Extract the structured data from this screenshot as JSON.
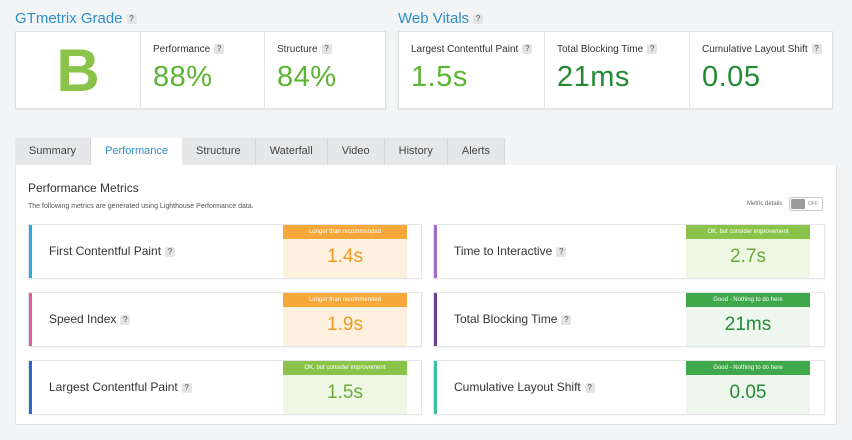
{
  "grade_section": {
    "title": "GTmetrix Grade",
    "grade": "B",
    "performance": {
      "label": "Performance",
      "value": "88%"
    },
    "structure": {
      "label": "Structure",
      "value": "84%"
    }
  },
  "web_vitals": {
    "title": "Web Vitals",
    "lcp": {
      "label": "Largest Contentful Paint",
      "value": "1.5s"
    },
    "tbt": {
      "label": "Total Blocking Time",
      "value": "21ms"
    },
    "cls": {
      "label": "Cumulative Layout Shift",
      "value": "0.05"
    }
  },
  "help_icon": "?",
  "tabs": [
    {
      "label": "Summary"
    },
    {
      "label": "Performance"
    },
    {
      "label": "Structure"
    },
    {
      "label": "Waterfall"
    },
    {
      "label": "Video"
    },
    {
      "label": "History"
    },
    {
      "label": "Alerts"
    }
  ],
  "active_tab": "Performance",
  "panel": {
    "title": "Performance Metrics",
    "description": "The following metrics are generated using Lighthouse Performance data.",
    "metric_details_label": "Metric details",
    "toggle_state": "OFF"
  },
  "metrics": [
    {
      "name": "First Contentful Paint",
      "status": "Longer than recommended",
      "value": "1.4s",
      "stripe": "#29a9e0",
      "badge": "orange"
    },
    {
      "name": "Time to Interactive",
      "status": "OK, but consider improvement",
      "value": "2.7s",
      "stripe": "#a26dc9",
      "badge": "lime"
    },
    {
      "name": "Speed Index",
      "status": "Longer than recommended",
      "value": "1.9s",
      "stripe": "#e05a9a",
      "badge": "orange"
    },
    {
      "name": "Total Blocking Time",
      "status": "Good - Nothing to do here",
      "value": "21ms",
      "stripe": "#6a3f8e",
      "badge": "green"
    },
    {
      "name": "Largest Contentful Paint",
      "status": "OK, but consider improvement",
      "value": "1.5s",
      "stripe": "#2a6bc9",
      "badge": "lime"
    },
    {
      "name": "Cumulative Layout Shift",
      "status": "Good - Nothing to do here",
      "value": "0.05",
      "stripe": "#3cbf9c",
      "badge": "green"
    }
  ],
  "colors": {
    "accent_blue": "#2e8fc9",
    "good_green": "#5cb531",
    "warn_orange": "#f7a83a",
    "ok_lime": "#8bc34a",
    "good_dark_green": "#3fa84a"
  }
}
